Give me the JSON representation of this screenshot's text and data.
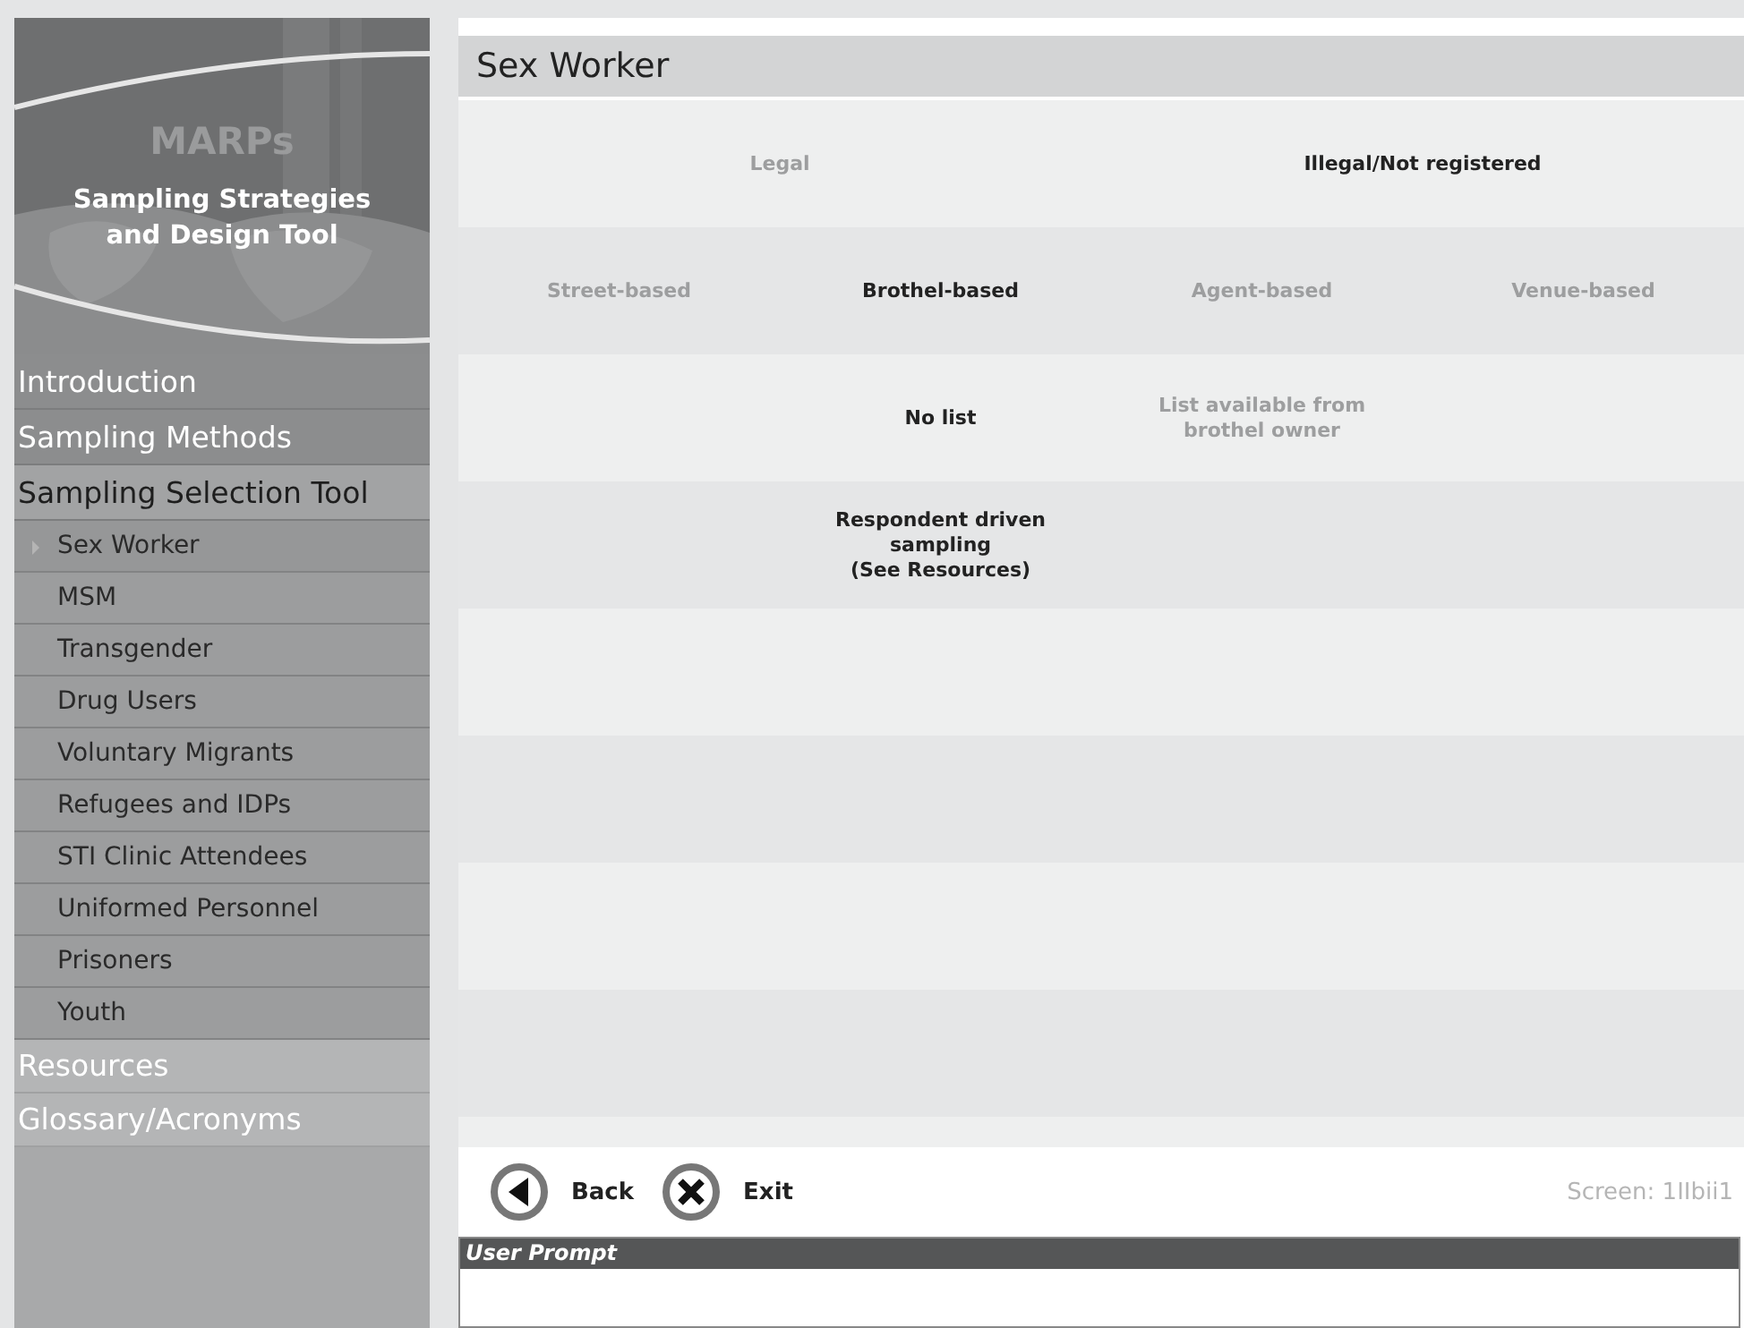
{
  "sidebar": {
    "logo": "MARPs",
    "title": "Sampling Strategies and Design Tool",
    "nav": [
      {
        "label": "Introduction",
        "selected": false,
        "kind": "top"
      },
      {
        "label": "Sampling Methods",
        "selected": false,
        "kind": "top"
      },
      {
        "label": "Sampling Selection Tool",
        "selected": true,
        "kind": "top",
        "children": [
          {
            "label": "Sex Worker",
            "selected": true
          },
          {
            "label": "MSM",
            "selected": false
          },
          {
            "label": "Transgender",
            "selected": false
          },
          {
            "label": "Drug Users",
            "selected": false
          },
          {
            "label": "Voluntary Migrants",
            "selected": false
          },
          {
            "label": "Refugees and IDPs",
            "selected": false
          },
          {
            "label": "STI Clinic Attendees",
            "selected": false
          },
          {
            "label": "Uniformed Personnel",
            "selected": false
          },
          {
            "label": "Prisoners",
            "selected": false
          },
          {
            "label": "Youth",
            "selected": false
          }
        ]
      },
      {
        "label": "Resources",
        "selected": false,
        "kind": "extra"
      },
      {
        "label": "Glossary/Acronyms",
        "selected": false,
        "kind": "extra"
      }
    ]
  },
  "page_title": "Sex Worker",
  "rows": [
    {
      "cells": [
        {
          "kind": "wide",
          "text": "Legal",
          "selected": false
        },
        {
          "kind": "wide",
          "text": "Illegal/Not registered",
          "selected": true
        }
      ]
    },
    {
      "cells": [
        {
          "kind": "cell",
          "text": "Street-based",
          "selected": false
        },
        {
          "kind": "cell",
          "text": "Brothel-based",
          "selected": true
        },
        {
          "kind": "cell",
          "text": "Agent-based",
          "selected": false
        },
        {
          "kind": "cell",
          "text": "Venue-based",
          "selected": false
        }
      ]
    },
    {
      "cells": [
        {
          "kind": "blank"
        },
        {
          "kind": "cell",
          "text": "No list",
          "selected": true
        },
        {
          "kind": "cell",
          "text": "List available from brothel owner",
          "selected": false
        },
        {
          "kind": "blank"
        }
      ]
    },
    {
      "cells": [
        {
          "kind": "blank"
        },
        {
          "kind": "cell",
          "text": "Respondent driven sampling\n(See Resources)",
          "selected": true
        },
        {
          "kind": "blank"
        },
        {
          "kind": "blank"
        }
      ]
    }
  ],
  "footer": {
    "buttons": [
      {
        "label": "Back",
        "kind": "back"
      },
      {
        "label": "Exit",
        "kind": "exit"
      }
    ],
    "screen_id": "Screen: 1IIbii1"
  },
  "user_prompt": {
    "title": "User Prompt"
  }
}
